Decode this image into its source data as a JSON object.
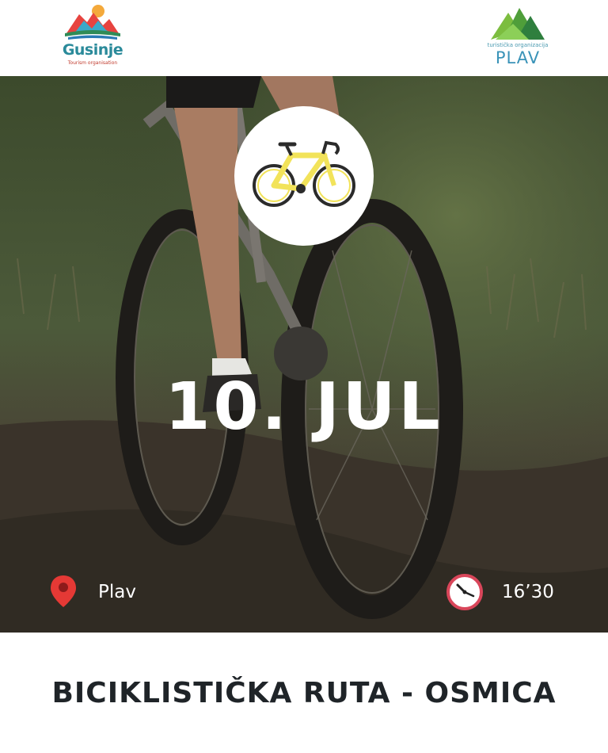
{
  "header": {
    "left_logo": {
      "name": "Gusinje",
      "tagline": "Tourism organisation"
    },
    "right_logo": {
      "tagline": "turistička organizacija",
      "name": "PLAV"
    }
  },
  "hero": {
    "date": "10. JUL",
    "location": "Plav",
    "time": "16’30",
    "icons": {
      "badge": "bicycle-icon",
      "location": "map-pin-icon",
      "time": "clock-icon"
    },
    "colors": {
      "pin": "#e53935",
      "clock_ring": "#d9465a",
      "bicycle": "#f2e35a"
    }
  },
  "footer": {
    "title": "BICIKLISTIČKA RUTA - OSMICA"
  }
}
